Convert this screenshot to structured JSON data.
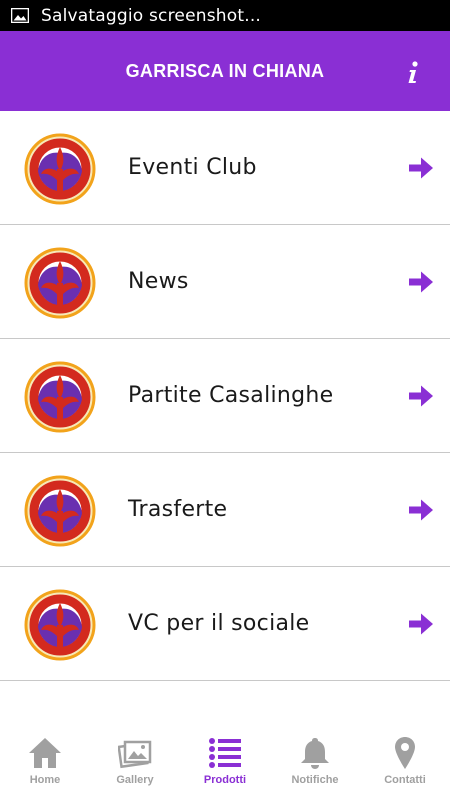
{
  "status_bar": {
    "notification_text": "Salvataggio screenshot..."
  },
  "header": {
    "title": "GARRISCA IN CHIANA",
    "info_icon": "info-icon"
  },
  "menu": {
    "items": [
      {
        "label": "Eventi Club"
      },
      {
        "label": "News"
      },
      {
        "label": "Partite Casalinghe"
      },
      {
        "label": "Trasferte"
      },
      {
        "label": "VC per il sociale"
      }
    ]
  },
  "bottom_nav": {
    "items": [
      {
        "label": "Home",
        "icon": "home-icon"
      },
      {
        "label": "Gallery",
        "icon": "gallery-icon"
      },
      {
        "label": "Prodotti",
        "icon": "list-icon",
        "active": true
      },
      {
        "label": "Notifiche",
        "icon": "bell-icon"
      },
      {
        "label": "Contatti",
        "icon": "location-pin-icon"
      }
    ]
  },
  "colors": {
    "accent": "#8a2fd4",
    "inactive": "#a0a0a0",
    "logo_red": "#d32a1e",
    "logo_gold": "#f2a31b"
  }
}
